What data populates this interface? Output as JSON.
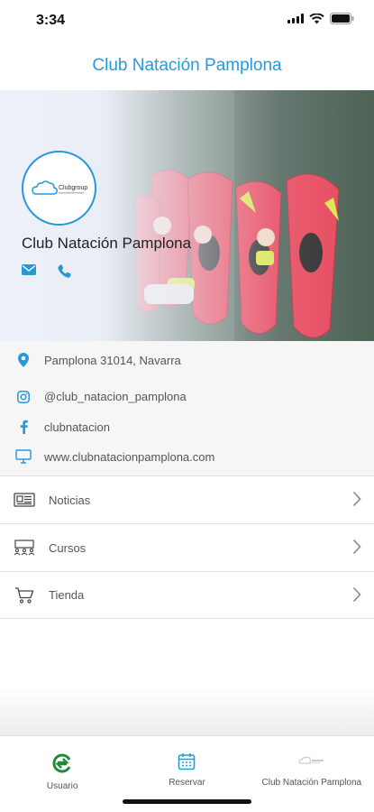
{
  "status_bar": {
    "time": "3:34"
  },
  "header": {
    "title": "Club Natación Pamplona"
  },
  "hero": {
    "club_name": "Club Natación Pamplona",
    "logo_text": "Clubgroup",
    "contact_icons": [
      "mail-icon",
      "phone-icon"
    ]
  },
  "info": {
    "address": "Pamplona 31014, Navarra",
    "instagram": "@club_natacion_pamplona",
    "facebook": "clubnatacion",
    "website": "www.clubnatacionpamplona.com"
  },
  "menu": {
    "items": [
      {
        "label": "Noticias",
        "icon": "newspaper-icon"
      },
      {
        "label": "Cursos",
        "icon": "classroom-icon"
      },
      {
        "label": "Tienda",
        "icon": "cart-icon"
      }
    ]
  },
  "tabbar": {
    "tabs": [
      {
        "label": "Usuario",
        "icon": "user-logo-icon"
      },
      {
        "label": "Reservar",
        "icon": "calendar-icon"
      },
      {
        "label": "Club Natación Pamplona",
        "icon": "club-logo-icon"
      }
    ]
  },
  "colors": {
    "accent": "#2a98d7",
    "green": "#1e8a3c",
    "kayak": "#e8455a"
  }
}
